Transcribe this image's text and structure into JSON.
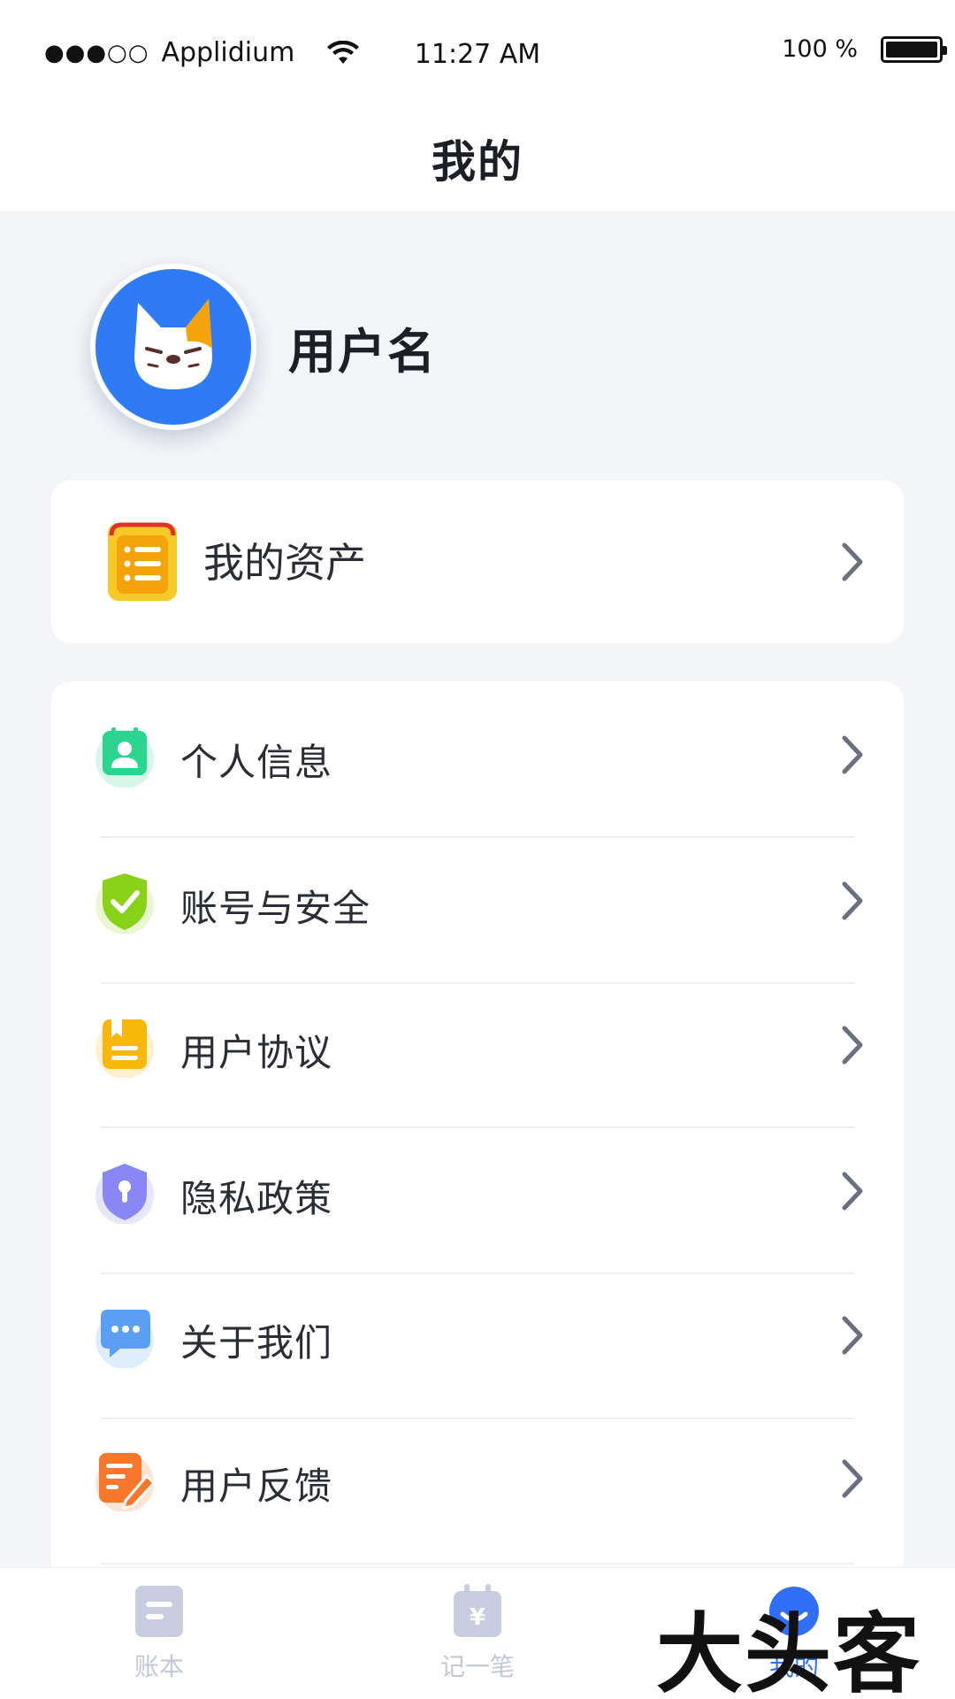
{
  "status_bar": {
    "carrier": "Applidium",
    "signal": "●●●○○",
    "time": "11:27 AM",
    "battery": "100 %"
  },
  "nav": {
    "title": "我的"
  },
  "profile": {
    "username": "用户名"
  },
  "assets": {
    "label": "我的资产"
  },
  "menu": [
    {
      "label": "个人信息",
      "icon": "person-card-icon"
    },
    {
      "label": "账号与安全",
      "icon": "shield-check-icon"
    },
    {
      "label": "用户协议",
      "icon": "document-icon"
    },
    {
      "label": "隐私政策",
      "icon": "lock-shield-icon"
    },
    {
      "label": "关于我们",
      "icon": "chat-bubble-icon"
    },
    {
      "label": "用户反馈",
      "icon": "edit-note-icon"
    }
  ],
  "tabbar": {
    "items": [
      {
        "label": "账本",
        "icon": "ledger-icon"
      },
      {
        "label": "记一笔",
        "icon": "calendar-yen-icon"
      },
      {
        "label": "我的",
        "icon": "smile-icon"
      }
    ]
  },
  "watermark": "大头客",
  "colors": {
    "accent": "#2f6ef5",
    "background": "#f4f5f8",
    "chevron": "#6b7080",
    "tab_inactive": "#c4c8d6"
  }
}
